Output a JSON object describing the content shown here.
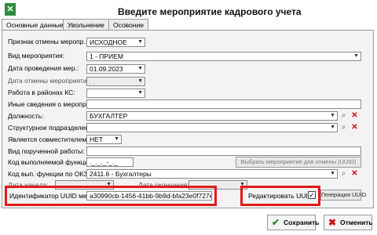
{
  "window": {
    "title": "Введите мероприятие кадрового учета",
    "close_glyph": "✕"
  },
  "tabs": [
    {
      "label": "Основные данные"
    },
    {
      "label": "Увольнение"
    },
    {
      "label": "Осовоние"
    }
  ],
  "form": {
    "sign_cancel": {
      "label": "Признак отмены меропр.:",
      "value": "ИСХОДНОЕ"
    },
    "event_type": {
      "label": "Вид мероприятия:",
      "value": "1 - ПРИЕМ"
    },
    "event_date": {
      "label": "Дата проведения мер.:",
      "value": "01.09.2023"
    },
    "cancel_date": {
      "label": "Дата отмены мероприятия",
      "value": ". ."
    },
    "ks_work": {
      "label": "Работа в районах КС:",
      "value": ""
    },
    "other_info": {
      "label": "Иные сведения о меропр.:",
      "value": ""
    },
    "position": {
      "label": "Должность:",
      "value": "БУХГАЛТЕР"
    },
    "struct_unit": {
      "label": "Структурное подразделен.:",
      "value": ""
    },
    "concurrent": {
      "label": "Является совместителем:",
      "value": "НЕТ"
    },
    "assigned_work": {
      "label": "Вид порученной работы:",
      "value": ""
    },
    "function_code": {
      "label": "Код выполняемой функции",
      "value": "._._._-_._"
    },
    "function_select_button": "Выбрать мероприятие для отмены (UUID)",
    "okz_code": {
      "label": "Код вып. функции по ОКЗ:",
      "value": "2411.6 - Бухгалтеры"
    },
    "start_date": {
      "label": "Дата начала:",
      "value": ". ."
    },
    "end_date": {
      "label": "Дата окончания:",
      "value": ". ."
    },
    "uuid": {
      "label": "Идентификатор UUID мер.:",
      "value": "a30990cb-1456-41bb-9b9d-bfa23e0f727e"
    },
    "edit_uuid": {
      "label": "Редактировать UUID",
      "checked": "✓"
    },
    "generate_uuid_button": "Генерация UUID"
  },
  "actions": {
    "save": {
      "label": "Сохранить",
      "icon": "check-icon",
      "color": "#2e8b3e"
    },
    "cancel": {
      "label": "Отменить",
      "icon": "close-icon",
      "color": "#cc1111"
    }
  },
  "colors": {
    "highlight": "#e21a1a",
    "accent_green": "#2e8b3e"
  }
}
